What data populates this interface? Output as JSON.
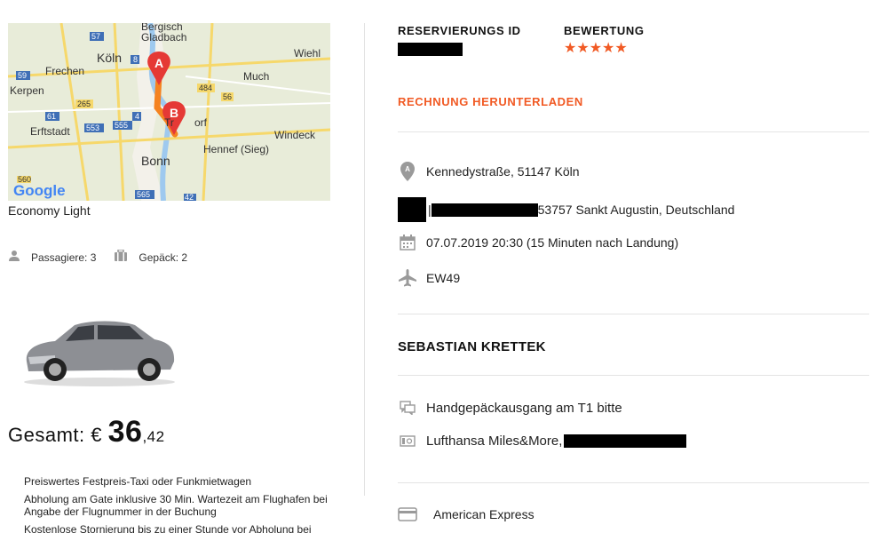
{
  "map": {
    "places": [
      "Bergisch",
      "Gladbach",
      "Köln",
      "Frechen",
      "Kerpen",
      "Erftstadt",
      "Bonn",
      "Much",
      "Wiehl",
      "Windeck",
      "Hennef (Sieg)",
      "Tr",
      "orf"
    ],
    "roads": [
      "57",
      "59",
      "8",
      "4",
      "265",
      "61",
      "553",
      "555",
      "484",
      "56",
      "565",
      "42",
      "560"
    ],
    "marker_a": "A",
    "marker_b": "B",
    "brand": "Google"
  },
  "car": {
    "class": "Economy Light",
    "passengers_label": "Passagiere: 3",
    "luggage_label": "Gepäck: 2"
  },
  "total": {
    "prefix": "Gesamt: €",
    "euros": "36",
    "cents": ",42"
  },
  "features": [
    "Preiswertes Festpreis-Taxi oder Funkmietwagen",
    "Abholung am Gate inklusive 30 Min. Wartezeit am Flughafen bei Angabe der Flugnummer in der Buchung",
    "Kostenlose Stornierung bis zu einer Stunde vor Abholung bei"
  ],
  "reservation": {
    "id_label": "RESERVIERUNGS ID",
    "rating_label": "BEWERTUNG",
    "stars": "★★★★★",
    "download_label": "RECHNUNG HERUNTERLADEN"
  },
  "trip": {
    "pickup": "Kennedystraße, 51147 Köln",
    "dropoff_sep": "|",
    "dropoff": "53757 Sankt Augustin, Deutschland",
    "datetime": "07.07.2019  20:30 (15 Minuten nach Landung)",
    "flight": "EW49"
  },
  "passenger": {
    "name": "SEBASTIAN KRETTEK",
    "note": "Handgepäckausgang am T1 bitte",
    "loyalty": "Lufthansa Miles&More,"
  },
  "payment": {
    "method": "American Express"
  },
  "colors": {
    "accent": "#f15a24",
    "route": "#f58220",
    "marker": "#e53935"
  }
}
